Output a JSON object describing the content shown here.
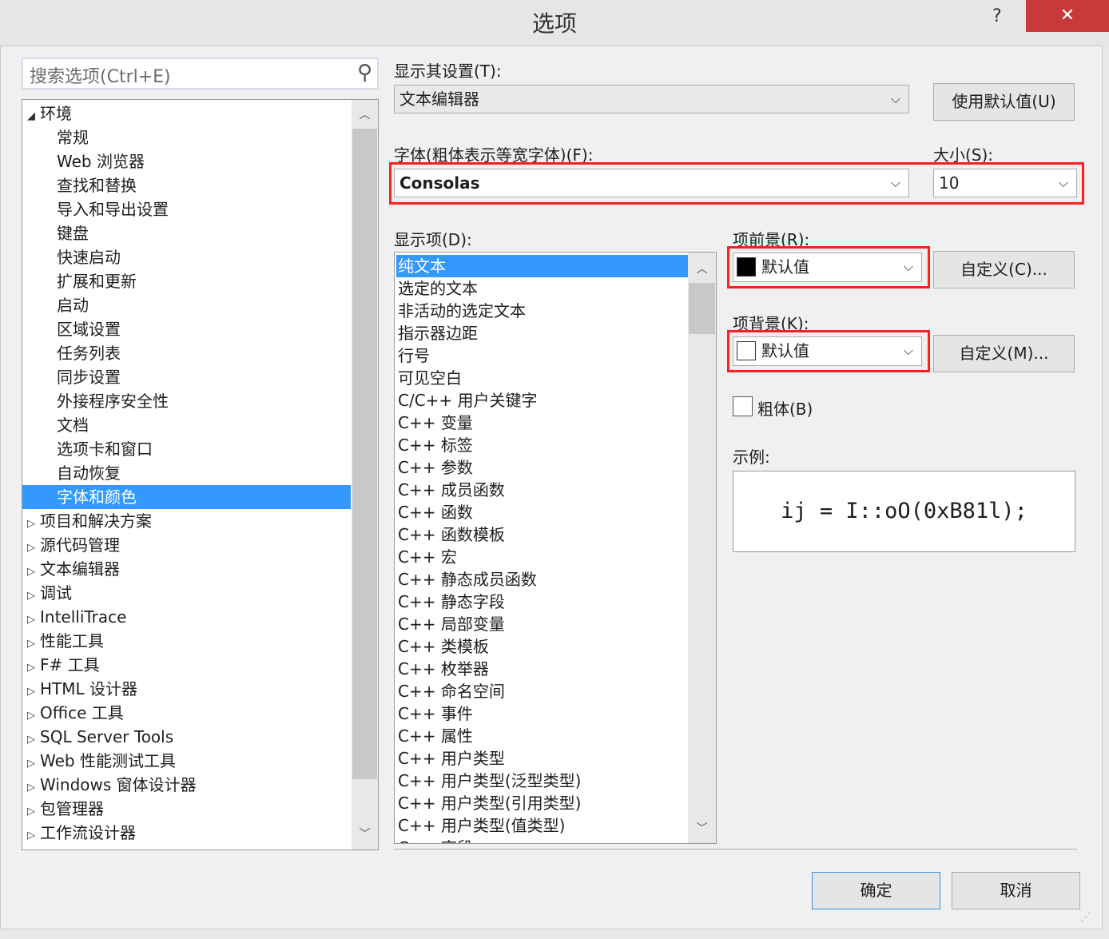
{
  "window": {
    "title": "选项",
    "help": "?",
    "close": "✕"
  },
  "search": {
    "placeholder": "搜索选项(Ctrl+E)",
    "icon": "search-icon"
  },
  "tree": {
    "items": [
      {
        "label": "环境",
        "expanded": true,
        "level": 0
      },
      {
        "label": "常规",
        "level": 1
      },
      {
        "label": "Web 浏览器",
        "level": 1
      },
      {
        "label": "查找和替换",
        "level": 1
      },
      {
        "label": "导入和导出设置",
        "level": 1
      },
      {
        "label": "键盘",
        "level": 1
      },
      {
        "label": "快速启动",
        "level": 1
      },
      {
        "label": "扩展和更新",
        "level": 1
      },
      {
        "label": "启动",
        "level": 1
      },
      {
        "label": "区域设置",
        "level": 1
      },
      {
        "label": "任务列表",
        "level": 1
      },
      {
        "label": "同步设置",
        "level": 1
      },
      {
        "label": "外接程序安全性",
        "level": 1
      },
      {
        "label": "文档",
        "level": 1
      },
      {
        "label": "选项卡和窗口",
        "level": 1
      },
      {
        "label": "自动恢复",
        "level": 1
      },
      {
        "label": "字体和颜色",
        "level": 1,
        "selected": true
      },
      {
        "label": "项目和解决方案",
        "level": 0
      },
      {
        "label": "源代码管理",
        "level": 0
      },
      {
        "label": "文本编辑器",
        "level": 0
      },
      {
        "label": "调试",
        "level": 0
      },
      {
        "label": "IntelliTrace",
        "level": 0
      },
      {
        "label": "性能工具",
        "level": 0
      },
      {
        "label": "F# 工具",
        "level": 0
      },
      {
        "label": "HTML 设计器",
        "level": 0
      },
      {
        "label": "Office 工具",
        "level": 0
      },
      {
        "label": "SQL Server Tools",
        "level": 0
      },
      {
        "label": "Web 性能测试工具",
        "level": 0
      },
      {
        "label": "Windows 窗体设计器",
        "level": 0
      },
      {
        "label": "包管理器",
        "level": 0
      },
      {
        "label": "工作流设计器",
        "level": 0
      }
    ]
  },
  "settings": {
    "show_settings_label": "显示其设置(T):",
    "show_settings_value": "文本编辑器",
    "use_defaults": "使用默认值(U)",
    "font_label": "字体(粗体表示等宽字体)(F):",
    "font_value": "Consolas",
    "size_label": "大小(S):",
    "size_value": "10",
    "display_items_label": "显示项(D):",
    "display_items": [
      "纯文本",
      "选定的文本",
      "非活动的选定文本",
      "指示器边距",
      "行号",
      "可见空白",
      "C/C++ 用户关键字",
      "C++ 变量",
      "C++ 标签",
      "C++ 参数",
      "C++ 成员函数",
      "C++ 函数",
      "C++ 函数模板",
      "C++ 宏",
      "C++ 静态成员函数",
      "C++ 静态字段",
      "C++ 局部变量",
      "C++ 类模板",
      "C++ 枚举器",
      "C++ 命名空间",
      "C++ 事件",
      "C++ 属性",
      "C++ 用户类型",
      "C++ 用户类型(泛型类型)",
      "C++ 用户类型(引用类型)",
      "C++ 用户类型(值类型)",
      "C++ 字段"
    ],
    "foreground_label": "项前景(R):",
    "foreground_value": "默认值",
    "foreground_color": "#000000",
    "custom_fg": "自定义(C)...",
    "background_label": "项背景(K):",
    "background_value": "默认值",
    "background_color": "#ffffff",
    "custom_bg": "自定义(M)...",
    "bold_label": "粗体(B)",
    "bold_checked": false,
    "sample_label": "示例:",
    "sample_text": "ij = I::oO(0xB81l);"
  },
  "footer": {
    "ok": "确定",
    "cancel": "取消"
  },
  "colors": {
    "selection": "#3399ff",
    "close": "#c7393a",
    "highlight": "#ff2020"
  }
}
